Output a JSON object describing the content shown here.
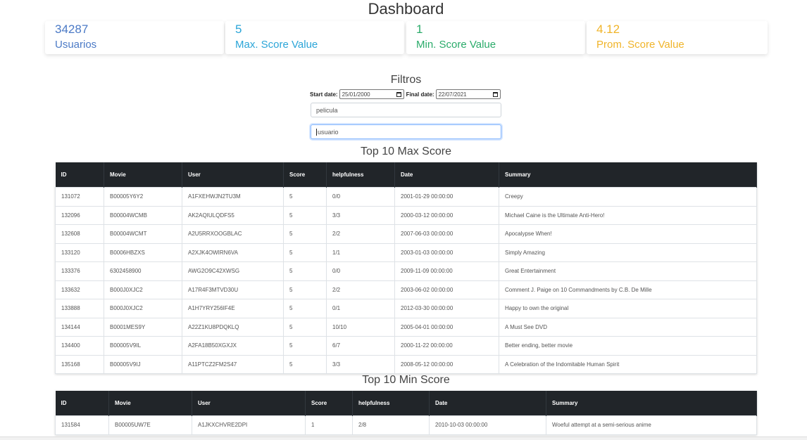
{
  "page_title": "Dashboard",
  "stats": [
    {
      "value": "34287",
      "label": "Usuarios",
      "color": "#4b7ac6"
    },
    {
      "value": "5",
      "label": "Max. Score Value",
      "color": "#2ba5d8"
    },
    {
      "value": "1",
      "label": "Min. Score Value",
      "color": "#2aab6a"
    },
    {
      "value": "4.12",
      "label": "Prom. Score Value",
      "color": "#f0b429"
    }
  ],
  "filters": {
    "title": "Filtros",
    "start_label": "Start date:",
    "start_value": "25/01/2000",
    "final_label": "Final date:",
    "final_value": "22/07/2021",
    "movie_placeholder": "pelicula",
    "user_placeholder": "usuario"
  },
  "max_table": {
    "title": "Top 10 Max Score",
    "headers": [
      "ID",
      "Movie",
      "User",
      "Score",
      "helpfulness",
      "Date",
      "Summary"
    ],
    "rows": [
      [
        "131072",
        "B00005Y6Y2",
        "A1FXEHWJN2TU3M",
        "5",
        "0/0",
        "2001-01-29 00:00:00",
        "Creepy"
      ],
      [
        "132096",
        "B00004WCMB",
        "AK2AQIULQDFS5",
        "5",
        "3/3",
        "2000-03-12 00:00:00",
        "Michael Caine is the Ultimate Anti-Hero!"
      ],
      [
        "132608",
        "B00004WCMT",
        "A2U5RRXOOGBLAC",
        "5",
        "2/2",
        "2007-06-03 00:00:00",
        "Apocalypse When!"
      ],
      [
        "133120",
        "B0006HBZXS",
        "A2XJK4OWIRN6VA",
        "5",
        "1/1",
        "2003-01-03 00:00:00",
        "Simply Amazing"
      ],
      [
        "133376",
        "6302458900",
        "AWG2O9C42XWSG",
        "5",
        "0/0",
        "2009-11-09 00:00:00",
        "Great Entertainment"
      ],
      [
        "133632",
        "B000J0XJC2",
        "A17R4F3MTVD30U",
        "5",
        "2/2",
        "2003-06-02 00:00:00",
        "Comment J. Paige on 10 Commandments by C.B. De Mille"
      ],
      [
        "133888",
        "B000J0XJC2",
        "A1H7YRY256IF4E",
        "5",
        "0/1",
        "2012-03-30 00:00:00",
        "Happy to own the original"
      ],
      [
        "134144",
        "B0001MES9Y",
        "A22Z1KU8PDQKLQ",
        "5",
        "10/10",
        "2005-04-01 00:00:00",
        "A Must See DVD"
      ],
      [
        "134400",
        "B00005V9IL",
        "A2FA18B50XGXJX",
        "5",
        "6/7",
        "2000-11-22 00:00:00",
        "Better ending, better movie"
      ],
      [
        "135168",
        "B00005V9IJ",
        "A11PTCZ2FM2S47",
        "5",
        "3/3",
        "2008-05-12 00:00:00",
        "A Celebration of the Indomitable Human Spirit"
      ]
    ]
  },
  "min_table": {
    "title": "Top 10 Min Score",
    "headers": [
      "ID",
      "Movie",
      "User",
      "Score",
      "helpfulness",
      "Date",
      "Summary"
    ],
    "rows": [
      [
        "131584",
        "B00005UW7E",
        "A1JKXCHVRE2DPI",
        "1",
        "2/8",
        "2010-10-03 00:00:00",
        "Woeful attempt at a semi-serious anime"
      ]
    ]
  }
}
